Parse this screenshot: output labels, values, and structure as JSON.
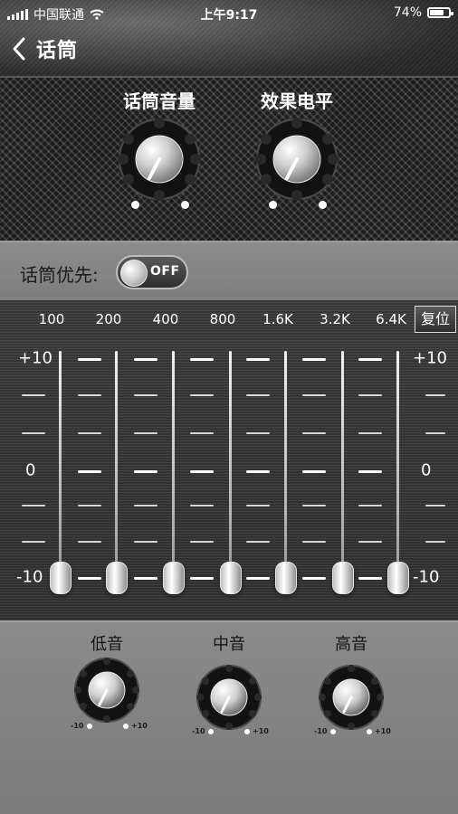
{
  "status": {
    "carrier": "中国联通",
    "time": "上午9:17",
    "battery": "74%",
    "battery_level_percent": 74
  },
  "nav": {
    "back_label": "话筒"
  },
  "mic_panel": {
    "left_label": "话筒音量",
    "right_label": "效果电平"
  },
  "priority": {
    "label": "话筒优先:",
    "toggle_text": "OFF"
  },
  "eq": {
    "reset_label": "复位",
    "bands": [
      "100",
      "200",
      "400",
      "800",
      "1.6K",
      "3.2K",
      "6.4K"
    ],
    "scale": {
      "top": "+10",
      "mid": "0",
      "bottom": "-10"
    },
    "sliders": [
      -10,
      -10,
      -10,
      -10,
      -10,
      -10,
      -10
    ]
  },
  "tone": {
    "low": {
      "label": "低音",
      "min": "-10",
      "max": "+10"
    },
    "mid": {
      "label": "中音",
      "min": "-10",
      "max": "+10"
    },
    "high": {
      "label": "高音",
      "min": "-10",
      "max": "+10"
    }
  }
}
